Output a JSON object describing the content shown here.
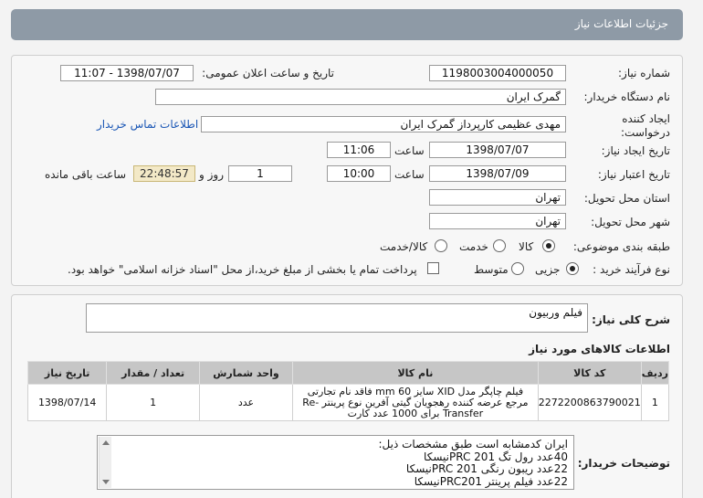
{
  "header": {
    "title": "جزئیات اطلاعات نیاز"
  },
  "form": {
    "need_number": {
      "label": "شماره نیاز:",
      "value": "1198003004000050"
    },
    "announce_datetime": {
      "label": "تاریخ و ساعت اعلان عمومی:",
      "value": "1398/07/07 - 11:07"
    },
    "buyer_org": {
      "label": "نام دستگاه خریدار:",
      "value": "گمرک ایران"
    },
    "requester": {
      "label": "ایجاد کننده درخواست:",
      "value": "مهدی عظیمی کارپرداز گمرک ایران",
      "contact_link": "اطلاعات تماس خریدار"
    },
    "created": {
      "label": "تاریخ ایجاد نیاز:",
      "date": "1398/07/07",
      "time_label": "ساعت",
      "time": "11:06"
    },
    "validity": {
      "label": "تاریخ اعتبار نیاز:",
      "date": "1398/07/09",
      "time_label": "ساعت",
      "time": "10:00",
      "days": "1",
      "days_label": "روز و",
      "remaining": "22:48:57",
      "remaining_label": "ساعت باقی مانده"
    },
    "province": {
      "label": "استان محل تحویل:",
      "value": "تهران"
    },
    "city": {
      "label": "شهر محل تحویل:",
      "value": "تهران"
    },
    "category": {
      "label": "طبقه بندی موضوعی:",
      "options": [
        "کالا",
        "خدمت",
        "کالا/خدمت"
      ],
      "selected": "کالا"
    },
    "process": {
      "label": "نوع فرآیند خرید :",
      "options": [
        "جزیی",
        "متوسط"
      ],
      "selected": "جزیی",
      "payment_note": "پرداخت تمام یا بخشی از مبلغ خرید،از محل \"اسناد خزانه اسلامی\" خواهد بود."
    }
  },
  "summary": {
    "label": "شرح کلی نیاز:",
    "value": "فیلم وربیون"
  },
  "items_section": {
    "title": "اطلاعات کالاهای مورد نیاز",
    "columns": [
      "ردیف",
      "کد کالا",
      "نام کالا",
      "واحد شمارش",
      "تعداد / مقدار",
      "تاریخ نیاز"
    ],
    "rows": [
      {
        "row": "1",
        "code": "2272200863790021",
        "name": "فیلم چاپگر مدل XID سایز 60 mm فاقد نام تجارتی مرجع عرضه کننده رهجویان گیتی آفرین نوع پرینتر Re-Transfer برای 1000 عدد کارت",
        "unit": "عدد",
        "qty": "1",
        "date": "1398/07/14"
      }
    ]
  },
  "buyer_notes": {
    "label": "توضیحات خریدار:",
    "lines": [
      "ایران کدمشابه است طبق مشخصات ذیل:",
      "40عدد رول تگ PRC 201نیسکا",
      "22عدد ریبون رنگی  PRC 201نیسکا",
      "22عدد  فیلم پرینتر  PRC201نیسکا"
    ]
  }
}
